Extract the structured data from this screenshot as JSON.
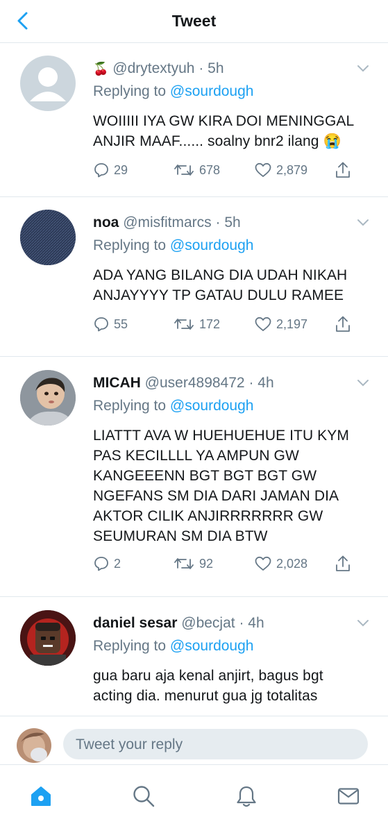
{
  "header": {
    "title": "Tweet"
  },
  "tweets": [
    {
      "emoji": "🍒",
      "name": "",
      "handle": "@drytextyuh",
      "time": "· 5h",
      "reply_prefix": "Replying to",
      "reply_to": "@sourdough",
      "text": "WOIIIII IYA GW KIRA DOI MENINGGAL\nANJIR MAAF...... soalny bnr2 ilang 😭",
      "replies": "29",
      "retweets": "678",
      "likes": "2,879"
    },
    {
      "emoji": "",
      "name": "noa",
      "handle": "@misfitmarcs",
      "time": "· 5h",
      "reply_prefix": "Replying to",
      "reply_to": "@sourdough",
      "text": "ADA YANG BILANG DIA UDAH NIKAH\nANJAYYYY TP GATAU DULU RAMEE",
      "replies": "55",
      "retweets": "172",
      "likes": "2,197"
    },
    {
      "emoji": "",
      "name": "MICAH",
      "handle": "@user4898472",
      "time": "· 4h",
      "reply_prefix": "Replying to",
      "reply_to": "@sourdough",
      "text": "LIATTT AVA W HUEHUEHUE ITU KYM\nPAS KECILLLL YA AMPUN GW\nKANGEEENN BGT BGT BGT GW\nNGEFANS SM DIA DARI JAMAN DIA\nAKTOR CILIK ANJIRRRRRRR GW\nSEUMURAN SM DIA BTW",
      "replies": "2",
      "retweets": "92",
      "likes": "2,028"
    },
    {
      "emoji": "",
      "name": "daniel sesar",
      "handle": "@becjat",
      "time": "· 4h",
      "reply_prefix": "Replying to",
      "reply_to": "@sourdough",
      "text": "gua baru aja kenal anjirt, bagus bgt\nacting dia. menurut gua jg totalitas",
      "replies": "",
      "retweets": "",
      "likes": ""
    }
  ],
  "composer": {
    "placeholder": "Tweet your reply"
  },
  "tabbar": {
    "items": [
      "home-icon",
      "search-icon",
      "notifications-icon",
      "messages-icon"
    ]
  },
  "colors": {
    "accent": "#1da1f2",
    "secondary_text": "#657786",
    "divider": "#e1e8ed",
    "reply_box": "#e6ecf0"
  }
}
